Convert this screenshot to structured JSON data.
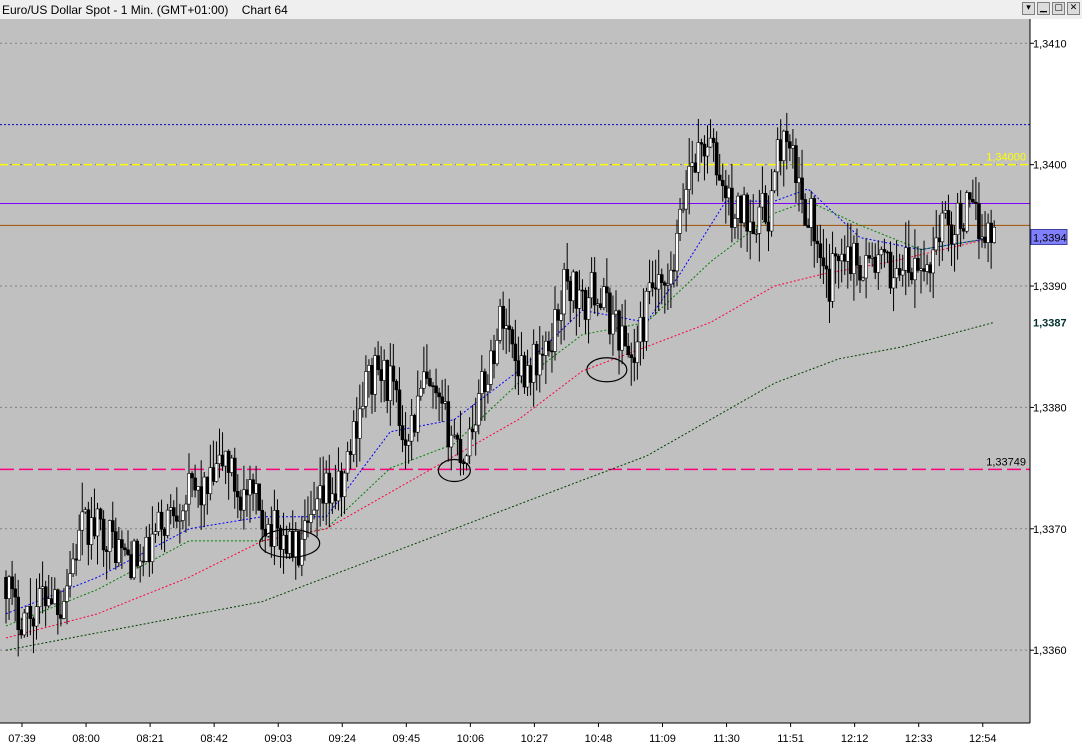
{
  "window": {
    "title": "Euro/US Dollar Spot - 1 Min. (GMT+01:00)    Chart 64",
    "buttons": [
      {
        "name": "restore-icon",
        "glyph": "▾"
      },
      {
        "name": "minimize-icon",
        "glyph": "▁"
      },
      {
        "name": "maximize-icon",
        "glyph": "▢"
      },
      {
        "name": "close-icon",
        "glyph": "✕"
      }
    ]
  },
  "chart_data": {
    "type": "candlestick",
    "instrument": "Euro/US Dollar Spot",
    "interval": "1 Min.",
    "background": "#c0c0c0",
    "grid": true,
    "ylim": [
      1.3354,
      1.3412
    ],
    "xlim": [
      0,
      330
    ],
    "y_ticks": [
      "1,3410",
      "1,3400",
      "1,3390",
      "1,3380",
      "1,3370",
      "1,3360"
    ],
    "y_tick_values": [
      1.341,
      1.34,
      1.339,
      1.338,
      1.337,
      1.336
    ],
    "x_ticks": [
      "07:39",
      "08:00",
      "08:21",
      "08:42",
      "09:03",
      "09:24",
      "09:45",
      "10:06",
      "10:27",
      "10:48",
      "11:09",
      "11:30",
      "11:51",
      "12:12",
      "12:33",
      "12:54"
    ],
    "x_tick_positions": [
      0,
      21,
      42,
      63,
      84,
      105,
      126,
      147,
      168,
      189,
      210,
      231,
      252,
      273,
      294,
      315
    ],
    "price_path": [
      [
        0,
        1.3366
      ],
      [
        3,
        1.3363
      ],
      [
        8,
        1.3363
      ],
      [
        14,
        1.3365
      ],
      [
        18,
        1.3364
      ],
      [
        25,
        1.337
      ],
      [
        32,
        1.337
      ],
      [
        38,
        1.3368
      ],
      [
        45,
        1.3367
      ],
      [
        50,
        1.337
      ],
      [
        56,
        1.3372
      ],
      [
        60,
        1.3373
      ],
      [
        66,
        1.3373
      ],
      [
        72,
        1.3376
      ],
      [
        76,
        1.3373
      ],
      [
        82,
        1.3372
      ],
      [
        87,
        1.337
      ],
      [
        92,
        1.3369
      ],
      [
        96,
        1.3368
      ],
      [
        100,
        1.337
      ],
      [
        105,
        1.3373
      ],
      [
        110,
        1.3373
      ],
      [
        114,
        1.3378
      ],
      [
        118,
        1.3382
      ],
      [
        122,
        1.3383
      ],
      [
        126,
        1.3382
      ],
      [
        130,
        1.3378
      ],
      [
        134,
        1.3379
      ],
      [
        137,
        1.3382
      ],
      [
        141,
        1.338
      ],
      [
        146,
        1.3378
      ],
      [
        150,
        1.3376
      ],
      [
        153,
        1.3379
      ],
      [
        157,
        1.3382
      ],
      [
        160,
        1.3385
      ],
      [
        163,
        1.3388
      ],
      [
        166,
        1.3385
      ],
      [
        170,
        1.3383
      ],
      [
        174,
        1.3384
      ],
      [
        177,
        1.3384
      ],
      [
        180,
        1.3387
      ],
      [
        183,
        1.339
      ],
      [
        186,
        1.339
      ],
      [
        189,
        1.3388
      ],
      [
        193,
        1.339
      ],
      [
        197,
        1.3388
      ],
      [
        200,
        1.3387
      ],
      [
        203,
        1.3385
      ],
      [
        206,
        1.3384
      ],
      [
        209,
        1.3387
      ],
      [
        212,
        1.339
      ],
      [
        215,
        1.3389
      ],
      [
        218,
        1.339
      ],
      [
        221,
        1.3395
      ],
      [
        224,
        1.34
      ],
      [
        227,
        1.3401
      ],
      [
        230,
        1.3402
      ],
      [
        234,
        1.3399
      ],
      [
        238,
        1.3396
      ],
      [
        242,
        1.3396
      ],
      [
        246,
        1.3396
      ],
      [
        250,
        1.3396
      ],
      [
        254,
        1.3402
      ],
      [
        258,
        1.34
      ],
      [
        261,
        1.3397
      ],
      [
        264,
        1.3396
      ],
      [
        267,
        1.3391
      ],
      [
        270,
        1.339
      ],
      [
        274,
        1.3394
      ],
      [
        278,
        1.3392
      ],
      [
        282,
        1.3392
      ],
      [
        286,
        1.3392
      ],
      [
        290,
        1.3391
      ],
      [
        294,
        1.3392
      ],
      [
        297,
        1.3391
      ],
      [
        300,
        1.3391
      ],
      [
        303,
        1.3392
      ],
      [
        306,
        1.3395
      ],
      [
        310,
        1.3395
      ],
      [
        315,
        1.3396
      ],
      [
        320,
        1.3395
      ],
      [
        324,
        1.3394
      ]
    ],
    "volatility": 0.00022,
    "candle_color": "#000000",
    "moving_averages": [
      {
        "color": "#0000ff",
        "dash": "2,2",
        "points": [
          [
            0,
            1.3363
          ],
          [
            30,
            1.3366
          ],
          [
            60,
            1.337
          ],
          [
            84,
            1.3371
          ],
          [
            105,
            1.3371
          ],
          [
            126,
            1.3378
          ],
          [
            147,
            1.3379
          ],
          [
            168,
            1.3383
          ],
          [
            189,
            1.3388
          ],
          [
            210,
            1.3387
          ],
          [
            221,
            1.3391
          ],
          [
            236,
            1.3397
          ],
          [
            252,
            1.3397
          ],
          [
            263,
            1.3398
          ],
          [
            280,
            1.3394
          ],
          [
            300,
            1.3393
          ],
          [
            324,
            1.3394
          ]
        ]
      },
      {
        "color": "#008000",
        "dash": "2,2",
        "points": [
          [
            0,
            1.3362
          ],
          [
            30,
            1.3365
          ],
          [
            60,
            1.3369
          ],
          [
            84,
            1.3369
          ],
          [
            105,
            1.337
          ],
          [
            126,
            1.3375
          ],
          [
            147,
            1.3377
          ],
          [
            168,
            1.3382
          ],
          [
            189,
            1.3386
          ],
          [
            210,
            1.3387
          ],
          [
            231,
            1.3392
          ],
          [
            252,
            1.3396
          ],
          [
            263,
            1.3397
          ],
          [
            280,
            1.3395
          ],
          [
            300,
            1.3393
          ],
          [
            324,
            1.3394
          ]
        ]
      },
      {
        "color": "#ff0040",
        "dash": "2,2",
        "points": [
          [
            0,
            1.3361
          ],
          [
            30,
            1.3363
          ],
          [
            60,
            1.3366
          ],
          [
            84,
            1.3369
          ],
          [
            105,
            1.337
          ],
          [
            126,
            1.3373
          ],
          [
            147,
            1.3376
          ],
          [
            168,
            1.3379
          ],
          [
            189,
            1.3383
          ],
          [
            210,
            1.3385
          ],
          [
            231,
            1.3387
          ],
          [
            252,
            1.339
          ],
          [
            268,
            1.3391
          ],
          [
            290,
            1.3392
          ],
          [
            324,
            1.3394
          ]
        ]
      },
      {
        "color": "#004000",
        "dash": "2,2",
        "points": [
          [
            0,
            1.336
          ],
          [
            42,
            1.3362
          ],
          [
            84,
            1.3364
          ],
          [
            126,
            1.3368
          ],
          [
            147,
            1.337
          ],
          [
            168,
            1.3372
          ],
          [
            189,
            1.3374
          ],
          [
            210,
            1.3376
          ],
          [
            231,
            1.3379
          ],
          [
            252,
            1.3382
          ],
          [
            273,
            1.3384
          ],
          [
            294,
            1.3385
          ],
          [
            324,
            1.3387
          ]
        ]
      }
    ],
    "horizontal_lines": [
      {
        "value": 1.34033,
        "color": "#0000c8",
        "style": "dotted",
        "label": ""
      },
      {
        "value": 1.34,
        "color": "#ffff00",
        "style": "dashed",
        "label": "1,34000"
      },
      {
        "value": 1.33968,
        "color": "#8000ff",
        "style": "solid",
        "label": ""
      },
      {
        "value": 1.3395,
        "color": "#a05000",
        "style": "solid",
        "label": ""
      },
      {
        "value": 1.33749,
        "color": "#ff0080",
        "style": "dashed",
        "label": "1,33749"
      }
    ],
    "circles": [
      {
        "x": 93,
        "y": 1.33688,
        "rx": 30,
        "ry": 14
      },
      {
        "x": 147,
        "y": 1.33748,
        "rx": 16,
        "ry": 11
      },
      {
        "x": 197,
        "y": 1.33831,
        "rx": 20,
        "ry": 12
      }
    ],
    "price_badges": [
      {
        "value": 1.3394,
        "label": "1,3394",
        "bg": "#8080ff",
        "fg": "#000000"
      },
      {
        "value": 1.3387,
        "label": "1,3387",
        "bg": "",
        "fg": "#003030"
      }
    ]
  }
}
